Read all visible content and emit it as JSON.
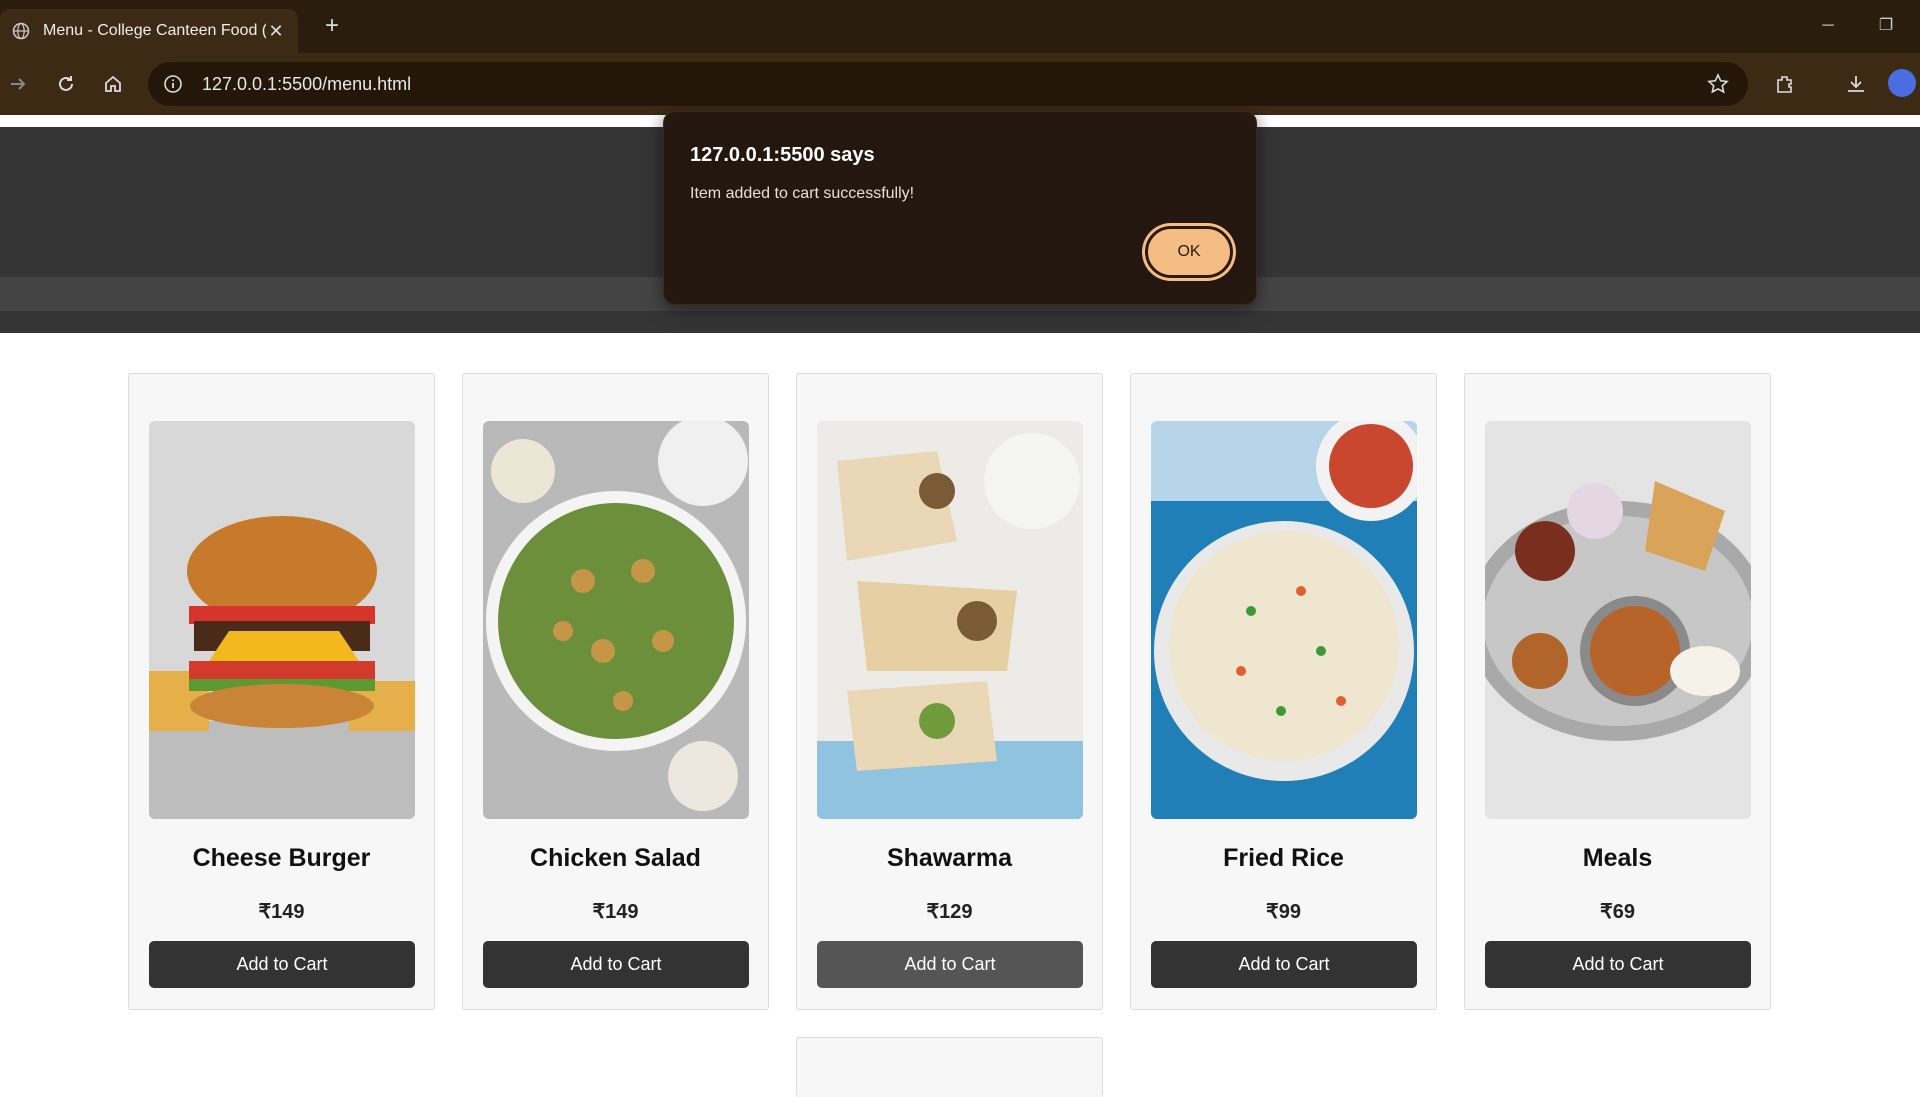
{
  "browser": {
    "tab_title": "Menu - College Canteen Food (",
    "url": "127.0.0.1:5500/menu.html"
  },
  "dialog": {
    "title": "127.0.0.1:5500 says",
    "message": "Item added to cart successfully!",
    "ok_label": "OK"
  },
  "menu": {
    "items": [
      {
        "name": "Cheese Burger",
        "price": "₹149",
        "button": "Add to Cart"
      },
      {
        "name": "Chicken Salad",
        "price": "₹149",
        "button": "Add to Cart"
      },
      {
        "name": "Shawarma",
        "price": "₹129",
        "button": "Add to Cart"
      },
      {
        "name": "Fried Rice",
        "price": "₹99",
        "button": "Add to Cart"
      },
      {
        "name": "Meals",
        "price": "₹69",
        "button": "Add to Cart"
      }
    ]
  },
  "colors": {
    "chrome_dark": "#2b1d0e",
    "toolbar": "#3d2a15",
    "hero": "#353535",
    "button": "#333333",
    "dialog_bg": "#24170f",
    "ok_button": "#f4bd84"
  }
}
